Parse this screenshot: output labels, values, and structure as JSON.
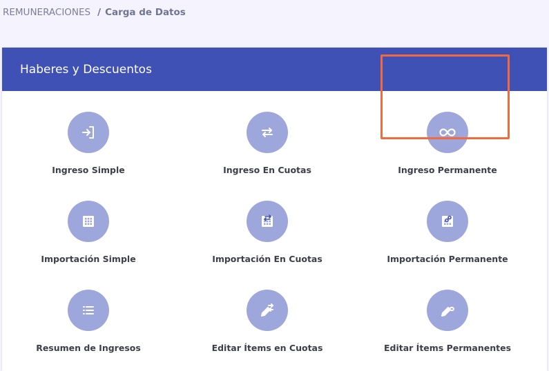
{
  "breadcrumb": {
    "section": "REMUNERACIONES",
    "separator": "/",
    "current": "Carga de Datos"
  },
  "card": {
    "title": "Haberes y Descuentos"
  },
  "tiles": [
    {
      "label": "Ingreso Simple",
      "icon": "login-icon"
    },
    {
      "label": "Ingreso En Cuotas",
      "icon": "swap-arrows-icon"
    },
    {
      "label": "Ingreso Permanente",
      "icon": "infinity-icon"
    },
    {
      "label": "Importación Simple",
      "icon": "grid-icon"
    },
    {
      "label": "Importación En Cuotas",
      "icon": "grid-swap-icon"
    },
    {
      "label": "Importación Permanente",
      "icon": "grid-link-icon"
    },
    {
      "label": "Resumen de Ingresos",
      "icon": "list-icon"
    },
    {
      "label": "Editar Ítems en Cuotas",
      "icon": "edit-swap-icon"
    },
    {
      "label": "Editar Ítems Permanentes",
      "icon": "edit-link-icon"
    }
  ],
  "colors": {
    "header": "#3f51b5",
    "icon_circle": "#9ea7dc",
    "highlight": "#f26a3c",
    "background": "#f5f3fe"
  }
}
